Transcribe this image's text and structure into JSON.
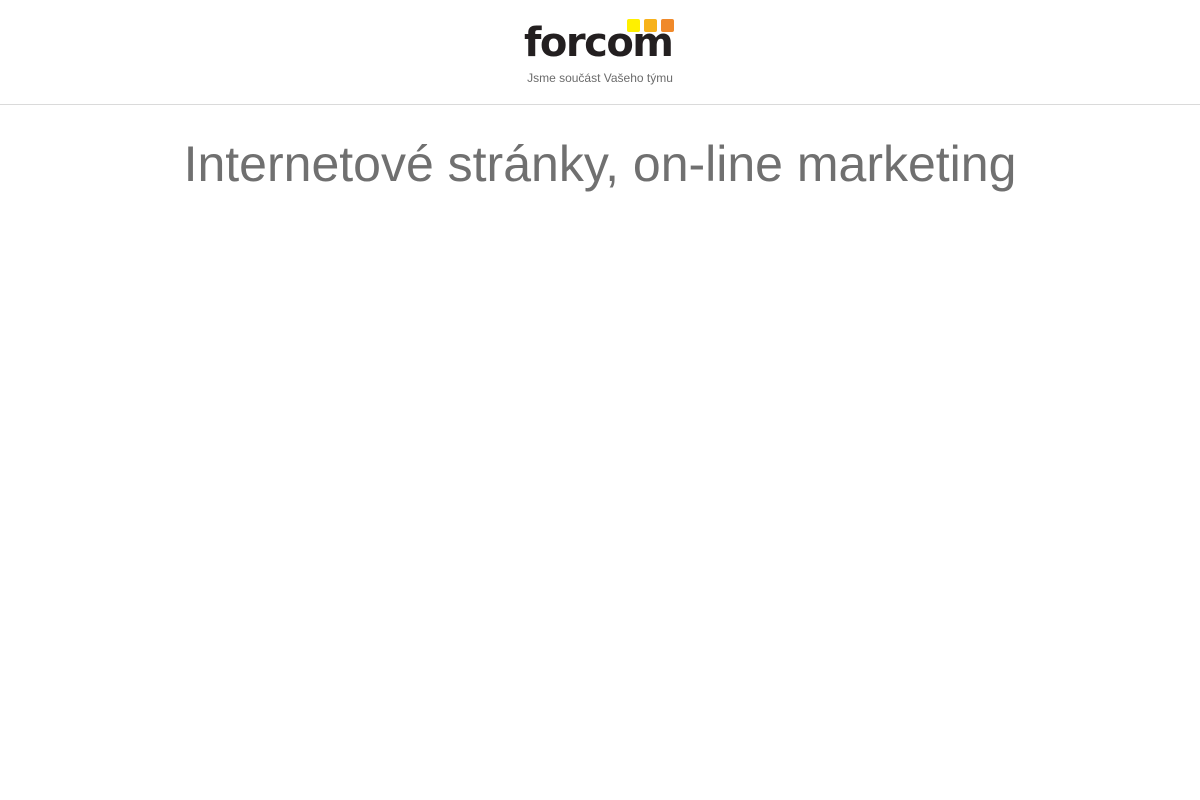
{
  "header": {
    "logo": {
      "wordmark": "forcom",
      "tagline": "Jsme součást Vašeho týmu",
      "square_colors": [
        "#fff000",
        "#f7b21b",
        "#f0892a"
      ],
      "wordmark_color": "#231f20"
    }
  },
  "main": {
    "title": "Internetové stránky, on-line marketing"
  },
  "colors": {
    "title": "#707070",
    "divider": "#dadada",
    "background": "#ffffff"
  }
}
